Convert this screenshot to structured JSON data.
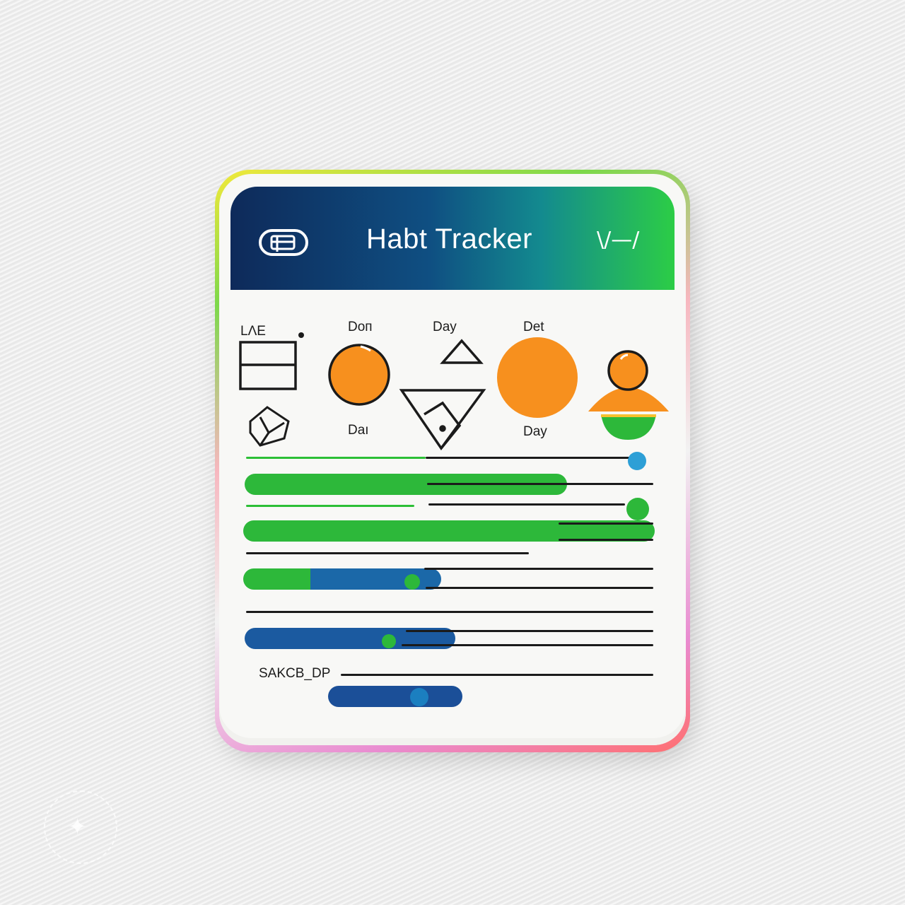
{
  "app": {
    "title": "Habt Tracker",
    "header_mark": "\\/—/"
  },
  "days": [
    {
      "top": "Doп",
      "bottom": "Daı"
    },
    {
      "top": "Day",
      "bottom": ""
    },
    {
      "top": "Det",
      "bottom": "Day"
    }
  ],
  "left_label": "LΛE",
  "section_label": "SAKCB_DP",
  "habits": [
    {
      "progress": 0.48,
      "color": "#2db83a"
    },
    {
      "progress": 0.76,
      "color": "#2db83a"
    },
    {
      "progress": 0.6,
      "color": "#2db83a",
      "second_color": "#1b68a8"
    },
    {
      "progress": 0.62,
      "color": "#1b5aa0"
    },
    {
      "progress": 0.52,
      "color": "#1b4f98"
    }
  ],
  "colors": {
    "accent_orange": "#f7901e",
    "accent_green": "#2db83a",
    "accent_blue": "#1b68a8",
    "header_start": "#0e2a5a",
    "header_end": "#2ccd46"
  },
  "icons": [
    "toggle-icon",
    "grid-box-icon",
    "cube-icon",
    "orange-circle-icon",
    "triangle-icon",
    "funnel-icon",
    "orange-sphere-icon",
    "person-icon",
    "progress-dot-icon"
  ]
}
